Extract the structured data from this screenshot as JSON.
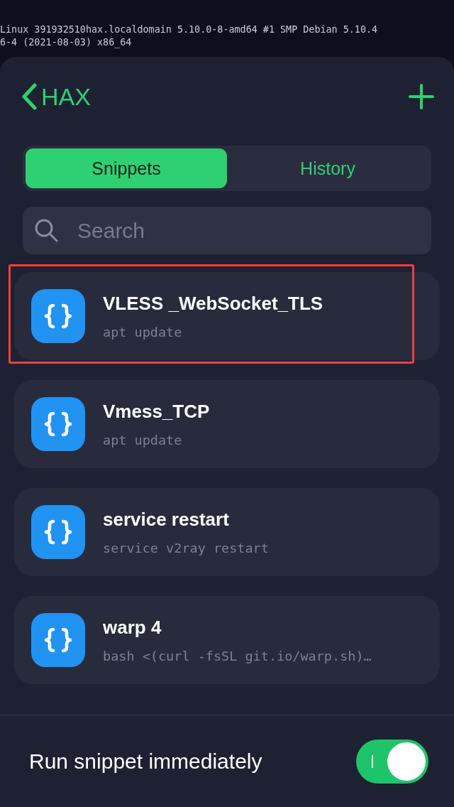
{
  "terminal": {
    "lines": [
      "Linux 391932510hax.localdomain 5.10.0-8-amd64 #1 SMP Debian 5.10.4",
      "6-4 (2021-08-03) x86_64"
    ]
  },
  "header": {
    "back_label": "HAX"
  },
  "tabs": [
    {
      "label": "Snippets",
      "selected": true
    },
    {
      "label": "History",
      "selected": false
    }
  ],
  "search": {
    "placeholder": "Search"
  },
  "snippets": [
    {
      "title": "VLESS _WebSocket_TLS",
      "command": "apt update",
      "highlighted": true
    },
    {
      "title": "Vmess_TCP",
      "command": "apt update",
      "highlighted": false
    },
    {
      "title": "service restart",
      "command": "service v2ray restart",
      "highlighted": false
    },
    {
      "title": "warp 4",
      "command": "bash <(curl -fsSL git.io/warp.sh)…",
      "highlighted": false
    }
  ],
  "footer": {
    "label": "Run snippet immediately",
    "on": true
  }
}
